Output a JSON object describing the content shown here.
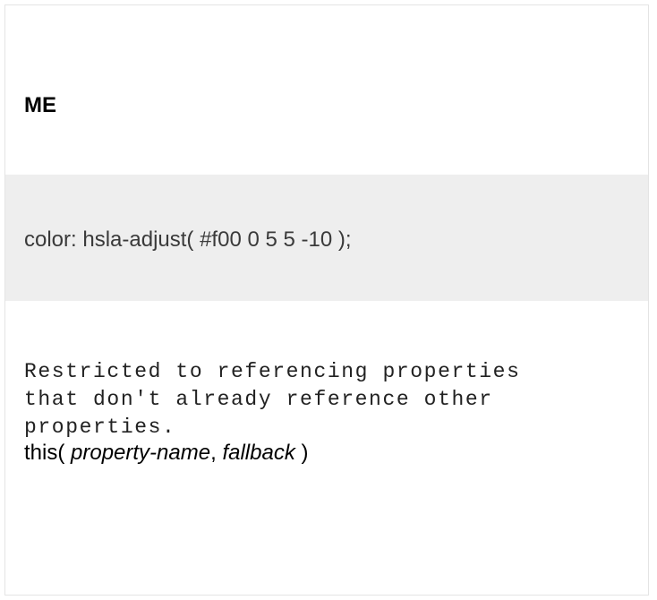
{
  "heading": "ME",
  "code_example": "color: hsla-adjust( #f00 0 5 5 -10 );",
  "note": "Restricted to referencing properties that don't already reference other properties.",
  "syntax": {
    "func_open": "this( ",
    "param1": "property-name",
    "separator": ", ",
    "param2": "fallback",
    "func_close": " )"
  }
}
